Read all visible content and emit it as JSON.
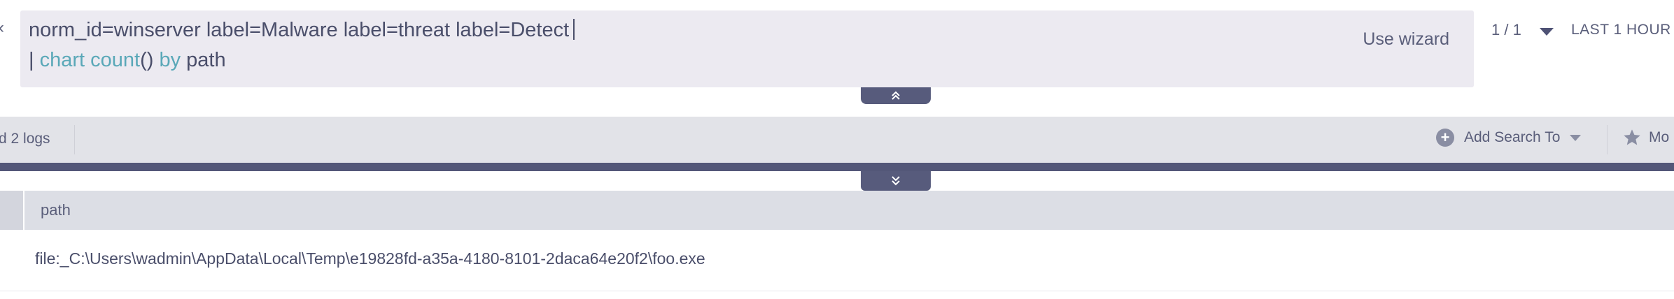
{
  "query": {
    "line1": "norm_id=winserver label=Malware label=threat label=Detect",
    "line2_pipe": "| ",
    "line2_func": "chart count",
    "line2_parens": "()",
    "line2_by": " by",
    "line2_field": " path",
    "use_wizard": "Use wizard"
  },
  "header": {
    "page_count": "1 / 1",
    "time_range": "LAST 1 HOUR"
  },
  "toolbar": {
    "found_logs": "d 2 logs",
    "add_search_to": "Add Search To",
    "more": "Mo"
  },
  "table": {
    "columns": [
      "path"
    ],
    "rows": [
      {
        "path": "file:_C:\\Users\\wadmin\\AppData\\Local\\Temp\\e19828fd-a35a-4180-8101-2daca64e20f2\\foo.exe"
      }
    ]
  },
  "colors": {
    "accent_dark": "#535778",
    "keyword": "#5aa8b8",
    "query_bg": "#eceaf1"
  }
}
